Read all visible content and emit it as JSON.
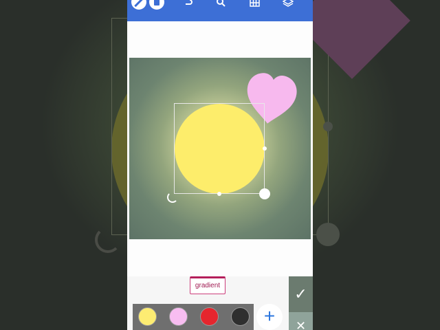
{
  "editor": {
    "toolbar": {
      "icons": [
        "pen-icon",
        "trash-icon",
        "undo-icon",
        "search-icon",
        "grid-icon",
        "layers-icon"
      ],
      "accent": "#3d6fd6"
    },
    "canvas": {
      "background_gradient": [
        "#f3f0b8",
        "#5d7366"
      ],
      "shapes": [
        {
          "type": "circle",
          "color": "#fded6b",
          "selected": true
        },
        {
          "type": "heart",
          "color": "#f7b9ee"
        }
      ]
    },
    "mode_tab": {
      "label": "gradient"
    },
    "palette": {
      "colors": [
        "#fdec72",
        "#f8bdf1",
        "#e5262e",
        "#2f2f2f"
      ],
      "add_label": "+"
    },
    "actions": {
      "confirm": "✓",
      "cancel": "✕"
    }
  }
}
